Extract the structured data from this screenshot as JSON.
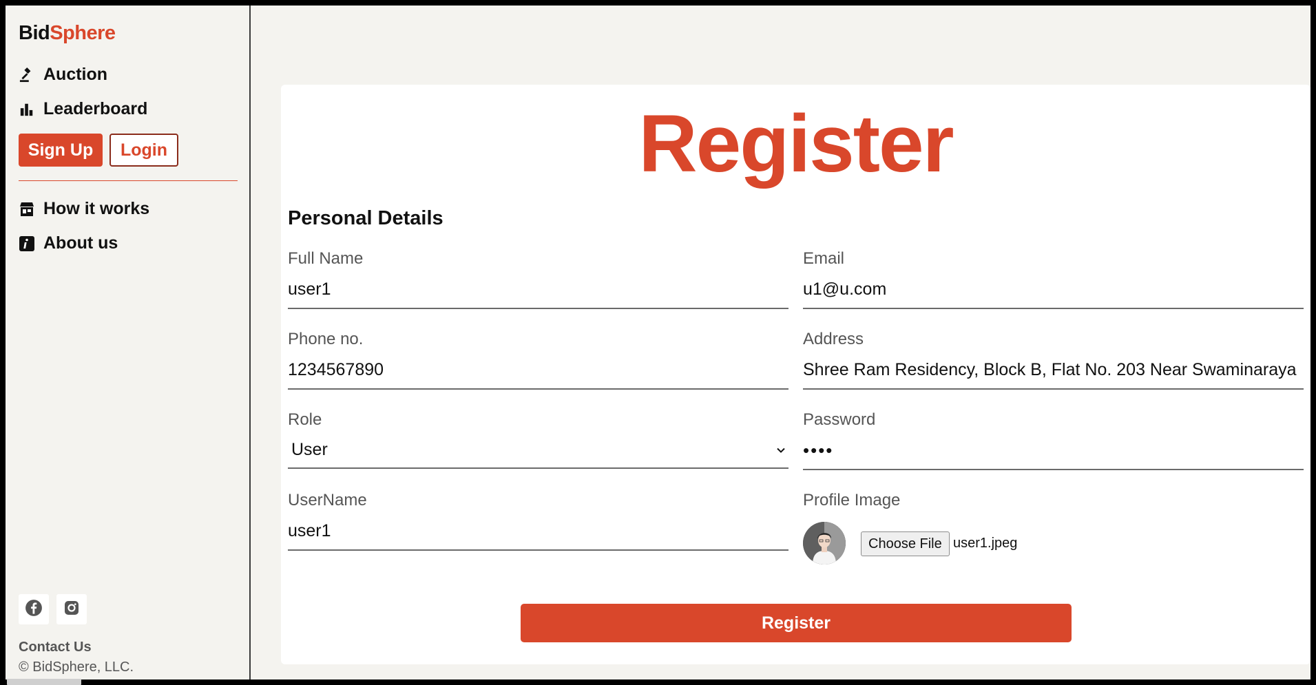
{
  "brand": {
    "prefix": "Bid",
    "accent": "Sphere"
  },
  "nav": {
    "auction": "Auction",
    "leaderboard": "Leaderboard",
    "how_it_works": "How it works",
    "about_us": "About us"
  },
  "auth": {
    "signup": "Sign Up",
    "login": "Login"
  },
  "footer": {
    "contact": "Contact Us",
    "copyright": "© BidSphere, LLC."
  },
  "form": {
    "title": "Register",
    "section": "Personal Details",
    "full_name": {
      "label": "Full Name",
      "value": "user1"
    },
    "email": {
      "label": "Email",
      "value": "u1@u.com"
    },
    "phone": {
      "label": "Phone no.",
      "value": "1234567890"
    },
    "address": {
      "label": "Address",
      "value": "Shree Ram Residency, Block B, Flat No. 203 Near Swaminaraya"
    },
    "role": {
      "label": "Role",
      "value": "User"
    },
    "password": {
      "label": "Password",
      "value": "••••"
    },
    "username": {
      "label": "UserName",
      "value": "user1"
    },
    "profile_image": {
      "label": "Profile Image",
      "button": "Choose File",
      "file": "user1.jpeg"
    },
    "submit": "Register"
  },
  "colors": {
    "accent": "#d9472b",
    "background": "#f4f3ef"
  },
  "icons": {
    "auction": "gavel-icon",
    "leaderboard": "bar-chart-icon",
    "how_it_works": "store-icon",
    "about_us": "info-icon",
    "facebook": "facebook-icon",
    "instagram": "instagram-icon",
    "role_select": "chevron-down-icon"
  }
}
